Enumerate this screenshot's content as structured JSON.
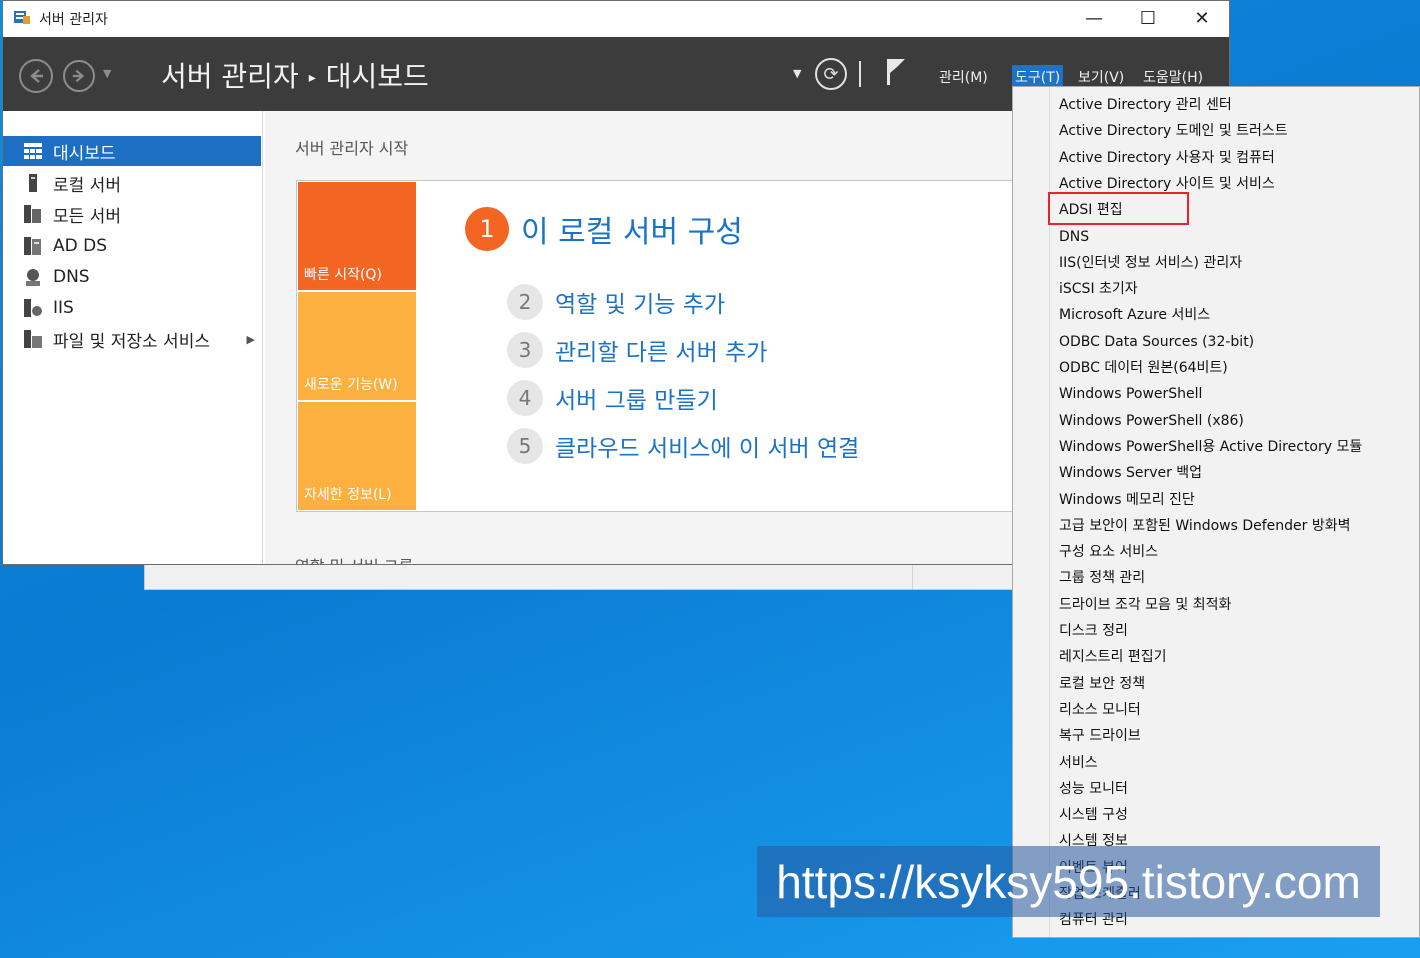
{
  "window": {
    "title": "서버 관리자",
    "minimize_glyph": "—",
    "maximize_glyph": "☐",
    "close_glyph": "✕"
  },
  "header": {
    "breadcrumb_root": "서버 관리자",
    "breadcrumb_sep": "▸",
    "breadcrumb_current": "대시보드",
    "menus": [
      {
        "label": "관리(M)"
      },
      {
        "label": "도구(T)"
      },
      {
        "label": "보기(V)"
      },
      {
        "label": "도움말(H)"
      }
    ],
    "active_menu": "도구(T)"
  },
  "sidebar": {
    "items": [
      {
        "label": "대시보드",
        "icon": "dashboard-icon"
      },
      {
        "label": "로컬 서버",
        "icon": "local-server-icon"
      },
      {
        "label": "모든 서버",
        "icon": "all-servers-icon"
      },
      {
        "label": "AD DS",
        "icon": "ad-ds-icon"
      },
      {
        "label": "DNS",
        "icon": "dns-icon"
      },
      {
        "label": "IIS",
        "icon": "iis-icon"
      },
      {
        "label": "파일 및 저장소 서비스",
        "icon": "file-storage-icon"
      }
    ],
    "selected": "대시보드"
  },
  "main": {
    "heading": "서버 관리자 시작",
    "tiles": [
      {
        "label": "빠른 시작(Q)"
      },
      {
        "label": "새로운 기능(W)"
      },
      {
        "label": "자세한 정보(L)"
      }
    ],
    "steps": [
      {
        "num": "1",
        "label": "이 로컬 서버 구성"
      },
      {
        "num": "2",
        "label": "역할 및 기능 추가"
      },
      {
        "num": "3",
        "label": "관리할 다른 서버 추가"
      },
      {
        "num": "4",
        "label": "서버 그룹 만들기"
      },
      {
        "num": "5",
        "label": "클라우드 서비스에 이 서버 연결"
      }
    ],
    "roles_heading": "역할 및 서버 그룹"
  },
  "tools_menu": {
    "items": [
      "Active Directory 관리 센터",
      "Active Directory 도메인 및 트러스트",
      "Active Directory 사용자 및 컴퓨터",
      "Active Directory 사이트 및 서비스",
      "ADSI 편집",
      "DNS",
      "IIS(인터넷 정보 서비스) 관리자",
      "iSCSI 초기자",
      "Microsoft Azure 서비스",
      "ODBC Data Sources (32-bit)",
      "ODBC 데이터 원본(64비트)",
      "Windows PowerShell",
      "Windows PowerShell (x86)",
      "Windows PowerShell용 Active Directory 모듈",
      "Windows Server 백업",
      "Windows 메모리 진단",
      "고급 보안이 포함된 Windows Defender 방화벽",
      "구성 요소 서비스",
      "그룹 정책 관리",
      "드라이브 조각 모음 및 최적화",
      "디스크 정리",
      "레지스트리 편집기",
      "로컬 보안 정책",
      "리소스 모니터",
      "복구 드라이브",
      "서비스",
      "성능 모니터",
      "시스템 구성",
      "시스템 정보",
      "이벤트 뷰어",
      "작업 스케줄러",
      "컴퓨터 관리"
    ],
    "highlighted": "ADSI 편집",
    "highlight_color": "#e8232b"
  },
  "watermark": "https://ksyksy595.tistory.com",
  "colors": {
    "header_bg": "#3c3c3c",
    "accent_blue": "#1c6fc3",
    "tile_orange": "#f26522",
    "tile_yellow": "#fbb040",
    "desktop_blue": "#0a7bd2"
  }
}
